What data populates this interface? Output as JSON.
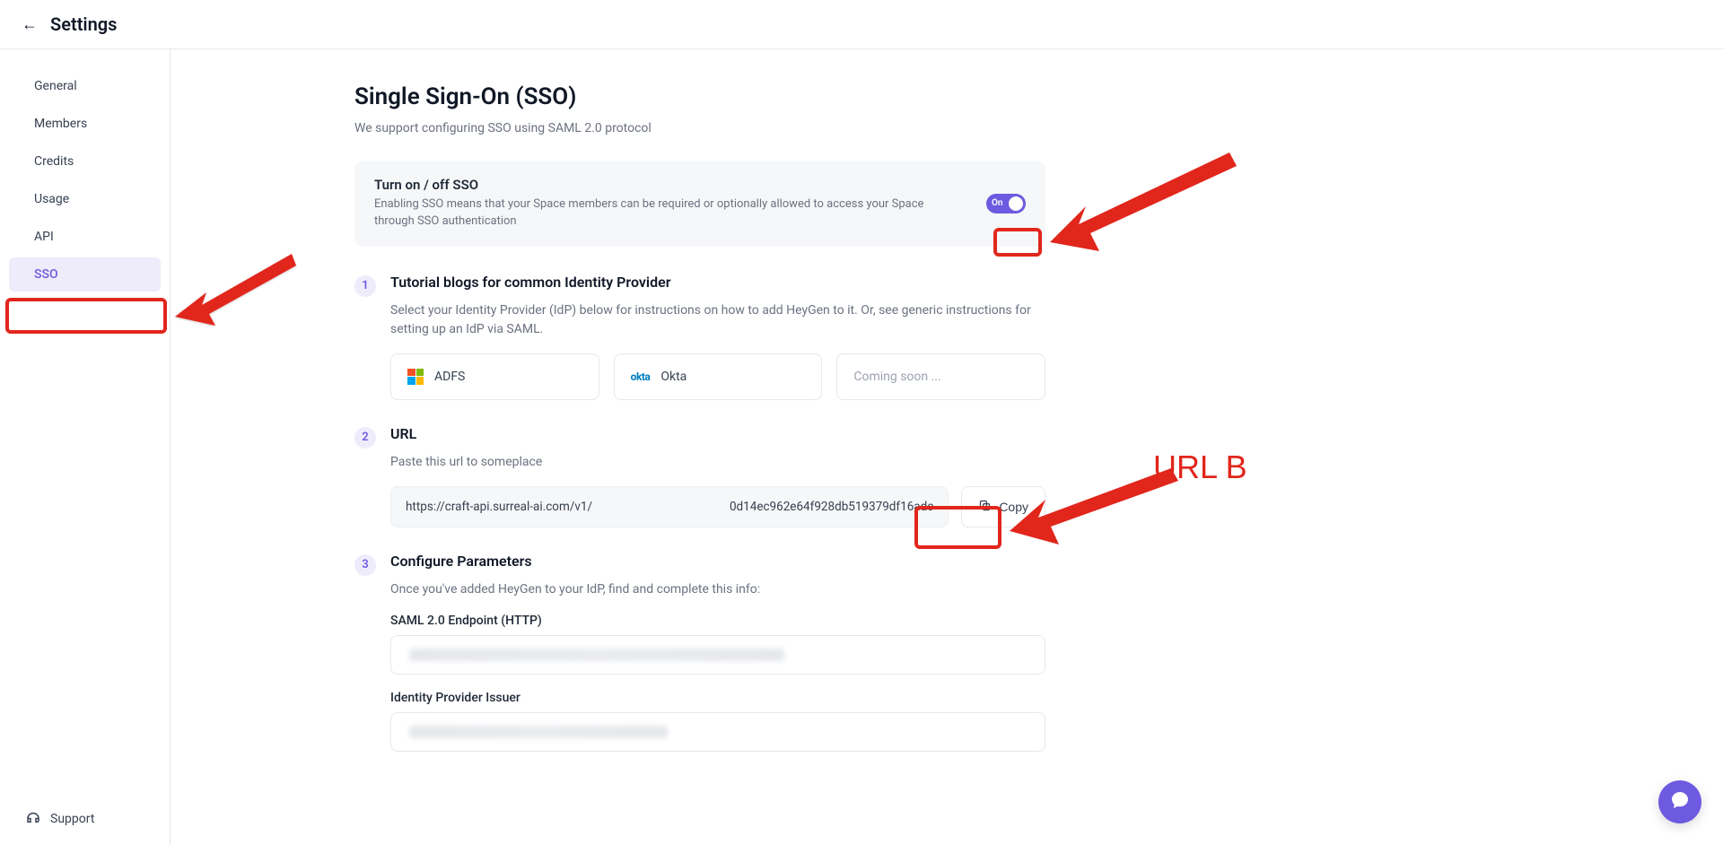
{
  "header": {
    "title": "Settings"
  },
  "sidebar": {
    "items": [
      {
        "label": "General"
      },
      {
        "label": "Members"
      },
      {
        "label": "Credits"
      },
      {
        "label": "Usage"
      },
      {
        "label": "API"
      },
      {
        "label": "SSO"
      }
    ],
    "support_label": "Support"
  },
  "page": {
    "title": "Single Sign-On (SSO)",
    "subtitle": "We support configuring SSO using SAML 2.0 protocol"
  },
  "toggle": {
    "title": "Turn on / off SSO",
    "desc": "Enabling SSO means that your Space members can be required or optionally allowed to access your Space through SSO authentication",
    "state_label": "On"
  },
  "step1": {
    "num": "1",
    "title": "Tutorial blogs for common Identity Provider",
    "desc": "Select your Identity Provider (IdP) below for instructions on how to add HeyGen to it. Or, see generic instructions for setting up an IdP via SAML.",
    "idps": [
      {
        "label": "ADFS"
      },
      {
        "label": "Okta"
      },
      {
        "label": "Coming soon ..."
      }
    ]
  },
  "step2": {
    "num": "2",
    "title": "URL",
    "desc": "Paste this url to someplace",
    "url_left": "https://craft-api.surreal-ai.com/v1/",
    "url_right": "0d14ec962e64f928db519379df16adc",
    "copy_label": "Copy"
  },
  "step3": {
    "num": "3",
    "title": "Configure Parameters",
    "desc": "Once you've added HeyGen to your IdP, find and complete this info:",
    "field1_label": "SAML 2.0 Endpoint (HTTP)",
    "field2_label": "Identity Provider Issuer"
  },
  "annotations": {
    "url_b": "URL B"
  }
}
